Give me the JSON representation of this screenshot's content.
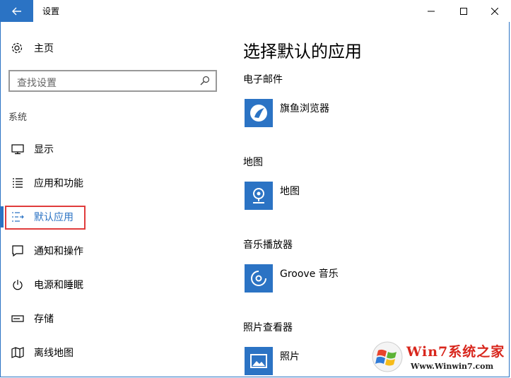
{
  "window": {
    "title": "设置"
  },
  "nav": {
    "home_label": "主页",
    "search_placeholder": "查找设置",
    "section_label": "系统",
    "items": [
      {
        "label": "显示",
        "icon": "monitor-icon"
      },
      {
        "label": "应用和功能",
        "icon": "list-icon"
      },
      {
        "label": "默认应用",
        "icon": "default-apps-icon",
        "active": true
      },
      {
        "label": "通知和操作",
        "icon": "notification-icon"
      },
      {
        "label": "电源和睡眠",
        "icon": "power-icon"
      },
      {
        "label": "存储",
        "icon": "storage-icon"
      },
      {
        "label": "离线地图",
        "icon": "map-icon"
      }
    ]
  },
  "main": {
    "title": "选择默认的应用",
    "categories": [
      {
        "label": "电子邮件",
        "app": "旗鱼浏览器",
        "icon": "browser-app-icon"
      },
      {
        "label": "地图",
        "app": "地图",
        "icon": "maps-app-icon"
      },
      {
        "label": "音乐播放器",
        "app": "Groove 音乐",
        "icon": "groove-music-icon"
      },
      {
        "label": "照片查看器",
        "app": "照片",
        "icon": "photos-app-icon"
      }
    ]
  },
  "watermark": {
    "title": "Win7系统之家",
    "url": "Www.Winwin7.com"
  },
  "colors": {
    "accent": "#2b73c4",
    "highlight": "#e03c3c"
  }
}
